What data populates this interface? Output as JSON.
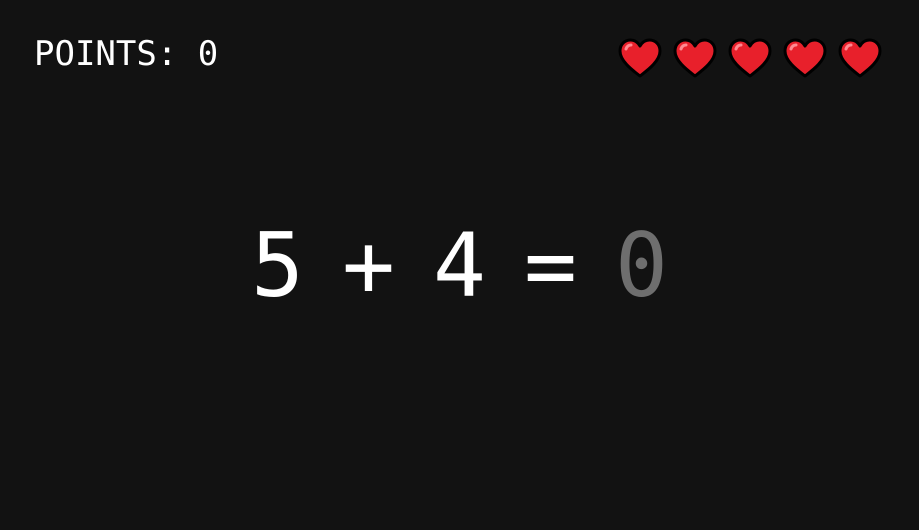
{
  "score": {
    "label": "POINTS: 0",
    "value": 0
  },
  "lives": {
    "count": 5,
    "max": 5,
    "icon": "heart-icon",
    "color": "#e8202b"
  },
  "equation": {
    "operand_a": "5",
    "operator": "+",
    "operand_b": "4",
    "equals": "=",
    "answer": "0",
    "answer_color": "#6e6e6e"
  },
  "colors": {
    "background": "#121212",
    "text": "#ffffff"
  }
}
